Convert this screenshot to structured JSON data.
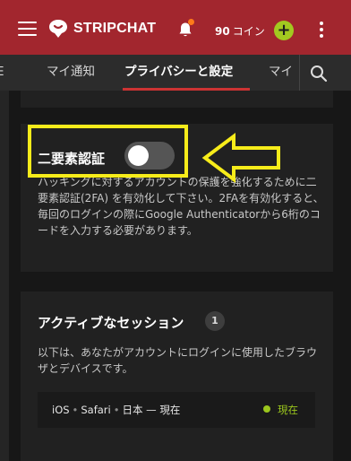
{
  "header": {
    "brand": "STRIPCHAT",
    "coin_count": "90",
    "coin_unit": "コイン",
    "plus_label": "+",
    "accent_color": "#a2262e",
    "icons": [
      "menu-icon",
      "logo-icon",
      "bell-icon",
      "plus-icon",
      "more-vert-icon"
    ]
  },
  "tabs": {
    "items": [
      {
        "label": "マイ通知"
      },
      {
        "label": "プライバシーと設定",
        "active": true
      },
      {
        "label": "マイ"
      }
    ],
    "search_icon": "search-icon",
    "partial_first": "E"
  },
  "twofa": {
    "title": "二要素認証",
    "enabled": false,
    "description": "ハッキングに対するアカウントの保護を強化するために二要素認証(2FA) を有効化して下さい。2FAを有効化すると、毎回のログインの際にGoogle Authenticatorから6桁のコードを入力する必要があります。"
  },
  "annotation": {
    "highlight_color": "#f7ec1a",
    "arrow_icon": "left-arrow-icon"
  },
  "sessions": {
    "title": "アクティブなセッション",
    "count": "1",
    "description": "以下は、あなたがアカウントにログインに使用したブラウザとデバイスです。",
    "rows": [
      {
        "os": "iOS",
        "browser": "Safari",
        "location_time": "日本 — 現在",
        "status": "現在",
        "status_color": "#9bc61d"
      }
    ]
  }
}
